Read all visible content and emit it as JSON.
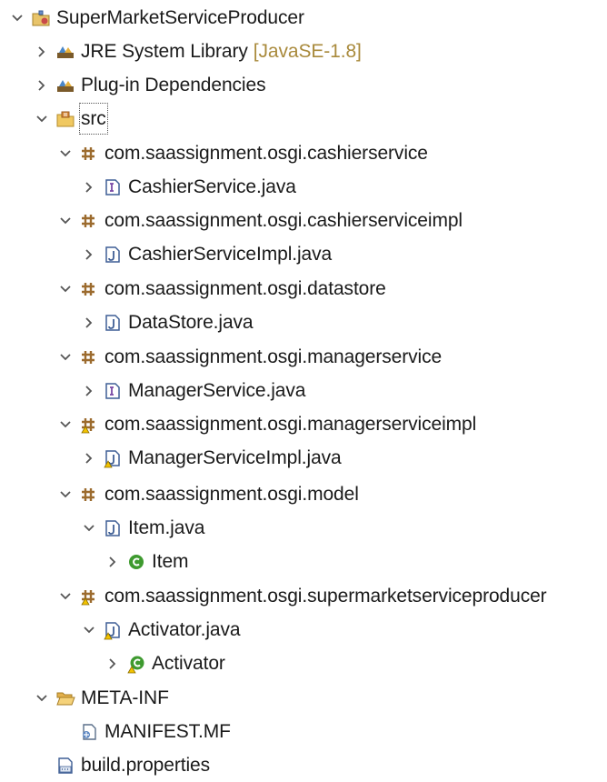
{
  "project_explorer": {
    "project": {
      "label": "SuperMarketServiceProducer",
      "expanded": true,
      "icon": "plugin-project-icon"
    },
    "jre": {
      "label": "JRE System Library",
      "decoration": "[JavaSE-1.8]",
      "icon": "library-icon"
    },
    "plugin_deps": {
      "label": "Plug-in Dependencies",
      "icon": "library-icon"
    },
    "src": {
      "label": "src",
      "icon": "source-folder-icon",
      "selected": true
    },
    "packages": [
      {
        "label": "com.saassignment.osgi.cashierservice",
        "icon": "package-icon",
        "file": {
          "label": "CashierService.java",
          "icon": "java-interface-file-icon"
        }
      },
      {
        "label": "com.saassignment.osgi.cashierserviceimpl",
        "icon": "package-icon",
        "file": {
          "label": "CashierServiceImpl.java",
          "icon": "java-file-icon"
        }
      },
      {
        "label": "com.saassignment.osgi.datastore",
        "icon": "package-icon",
        "file": {
          "label": "DataStore.java",
          "icon": "java-file-icon"
        }
      },
      {
        "label": "com.saassignment.osgi.managerservice",
        "icon": "package-icon",
        "file": {
          "label": "ManagerService.java",
          "icon": "java-interface-file-icon"
        }
      },
      {
        "label": "com.saassignment.osgi.managerserviceimpl",
        "icon": "package-warning-icon",
        "file": {
          "label": "ManagerServiceImpl.java",
          "icon": "java-file-warning-icon"
        }
      },
      {
        "label": "com.saassignment.osgi.model",
        "icon": "package-icon",
        "file": {
          "label": "Item.java",
          "icon": "java-file-icon"
        },
        "type": {
          "label": "Item",
          "icon": "class-icon"
        }
      },
      {
        "label": "com.saassignment.osgi.supermarketserviceproducer",
        "icon": "package-warning-icon",
        "file": {
          "label": "Activator.java",
          "icon": "java-file-warning-icon"
        },
        "type": {
          "label": "Activator",
          "icon": "class-warning-icon"
        }
      }
    ],
    "meta_inf": {
      "label": "META-INF",
      "icon": "folder-open-icon"
    },
    "manifest": {
      "label": "MANIFEST.MF",
      "icon": "manifest-file-icon"
    },
    "build_properties": {
      "label": "build.properties",
      "icon": "properties-file-icon"
    }
  },
  "colors": {
    "decoration": "#a98a3c",
    "package": "#9c6b2e",
    "java_file": "#3f5f95",
    "class_green": "#3e9a2f",
    "warning": "#e2a500",
    "folder": "#e3b04b"
  }
}
